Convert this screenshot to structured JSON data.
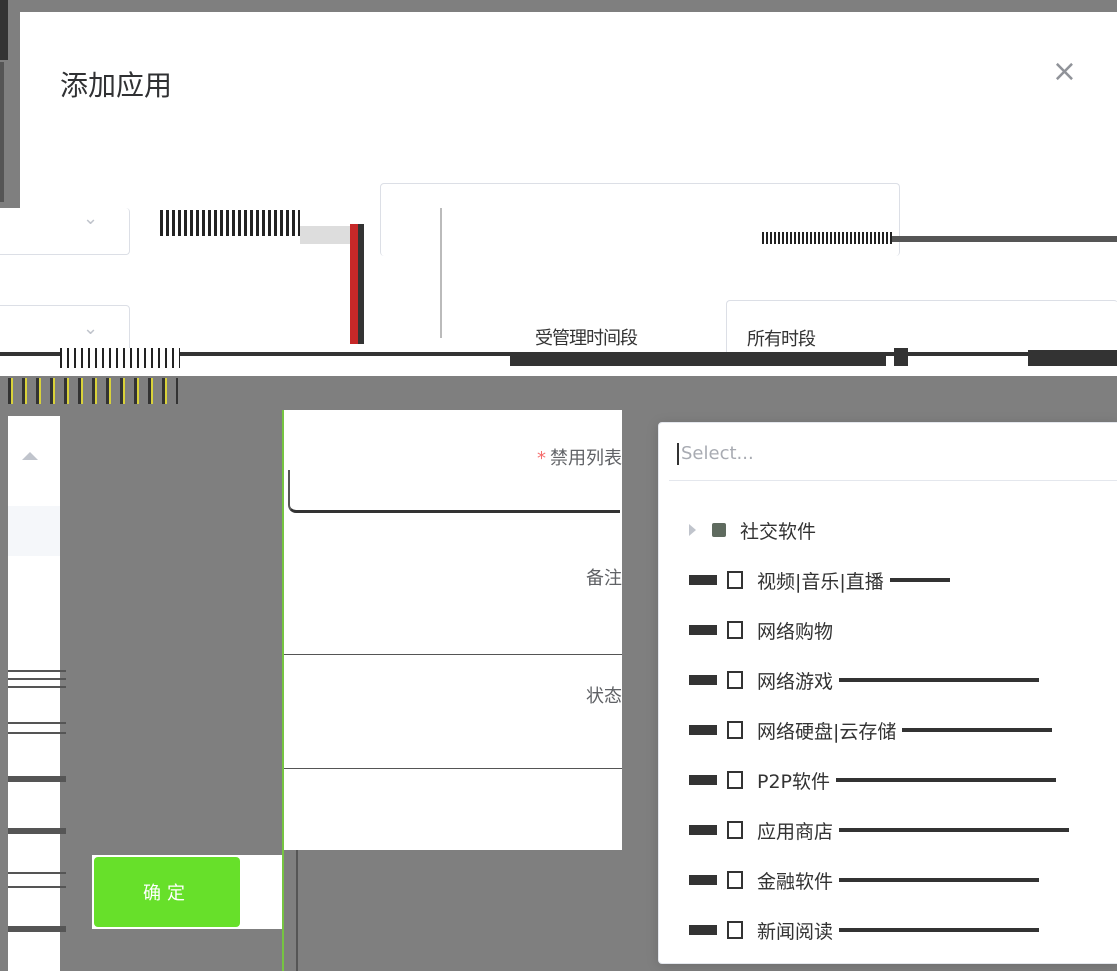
{
  "dialog": {
    "title": "添加应用",
    "close_symbol": "×"
  },
  "upper_form": {
    "time_label": "受管理时间段",
    "time_value": "所有时段"
  },
  "form": {
    "block_list_label": "禁用列表",
    "required_mark": "*",
    "remark_label": "备注",
    "status_label": "状态",
    "confirm_label": "确定"
  },
  "dropdown": {
    "placeholder": "Select...",
    "items": [
      {
        "label": "社交软件",
        "state": "partial",
        "expandable": true
      },
      {
        "label": "视频|音乐|直播",
        "state": "unchecked",
        "expandable": false
      },
      {
        "label": "网络购物",
        "state": "unchecked",
        "expandable": false
      },
      {
        "label": "网络游戏",
        "state": "unchecked",
        "expandable": false
      },
      {
        "label": "网络硬盘|云存储",
        "state": "unchecked",
        "expandable": false
      },
      {
        "label": "P2P软件",
        "state": "unchecked",
        "expandable": false
      },
      {
        "label": "应用商店",
        "state": "unchecked",
        "expandable": false
      },
      {
        "label": "金融软件",
        "state": "unchecked",
        "expandable": false
      },
      {
        "label": "新闻阅读",
        "state": "unchecked",
        "expandable": false
      }
    ]
  },
  "colors": {
    "backdrop": "#7f7f7f",
    "confirm_button": "#67e02a",
    "required": "#f56c6c"
  }
}
